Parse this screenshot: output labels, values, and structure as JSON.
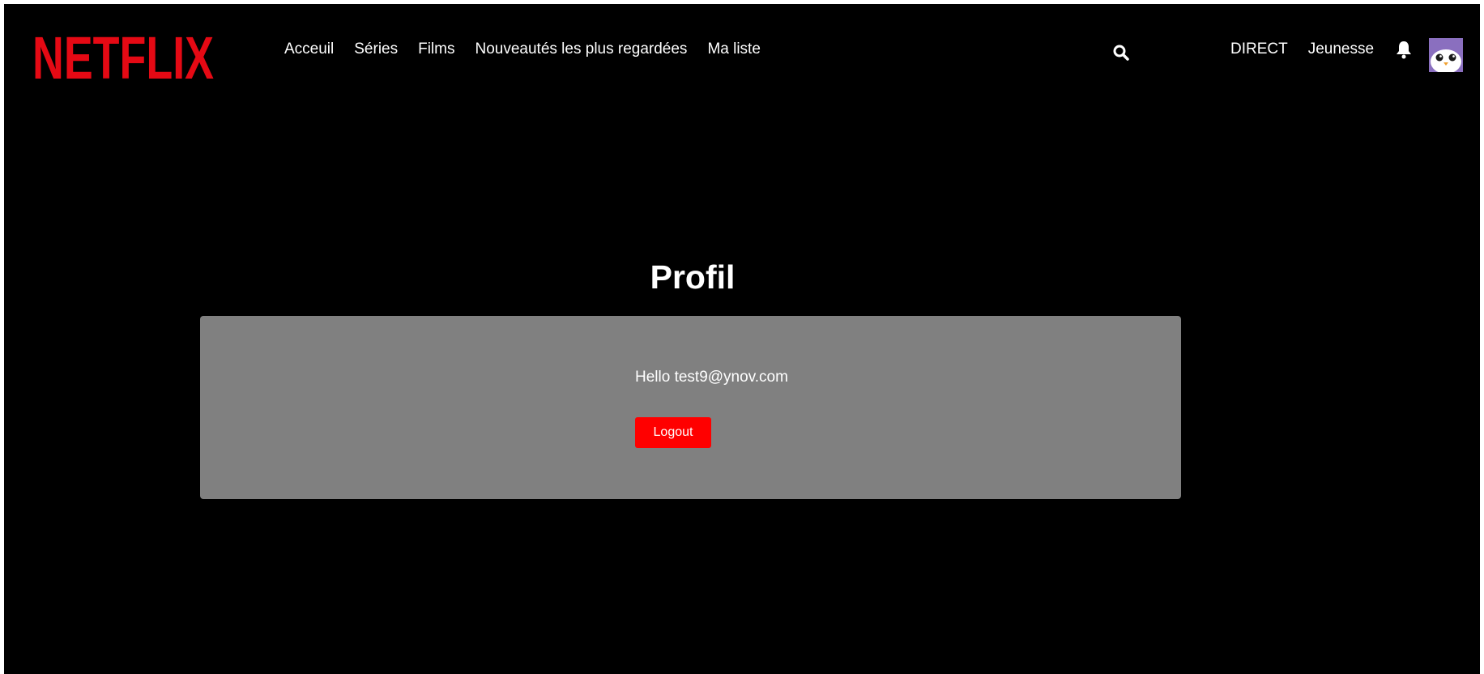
{
  "header": {
    "logo_text": "NETFLIX",
    "nav_items": [
      {
        "label": "Acceuil"
      },
      {
        "label": "Séries"
      },
      {
        "label": "Films"
      },
      {
        "label": "Nouveautés les plus regardées"
      },
      {
        "label": "Ma liste"
      }
    ],
    "right_items": [
      {
        "label": "DIRECT"
      },
      {
        "label": "Jeunesse"
      }
    ],
    "search_icon": "search-icon",
    "bell_icon": "bell-icon",
    "avatar_icon": "penguin-avatar"
  },
  "profile": {
    "title": "Profil",
    "greeting": "Hello test9@ynov.com",
    "logout_label": "Logout"
  },
  "colors": {
    "brand_red": "#e50914",
    "background": "#000000",
    "card": "#808080",
    "button": "#ff0000",
    "avatar": "#8a6fbf"
  }
}
